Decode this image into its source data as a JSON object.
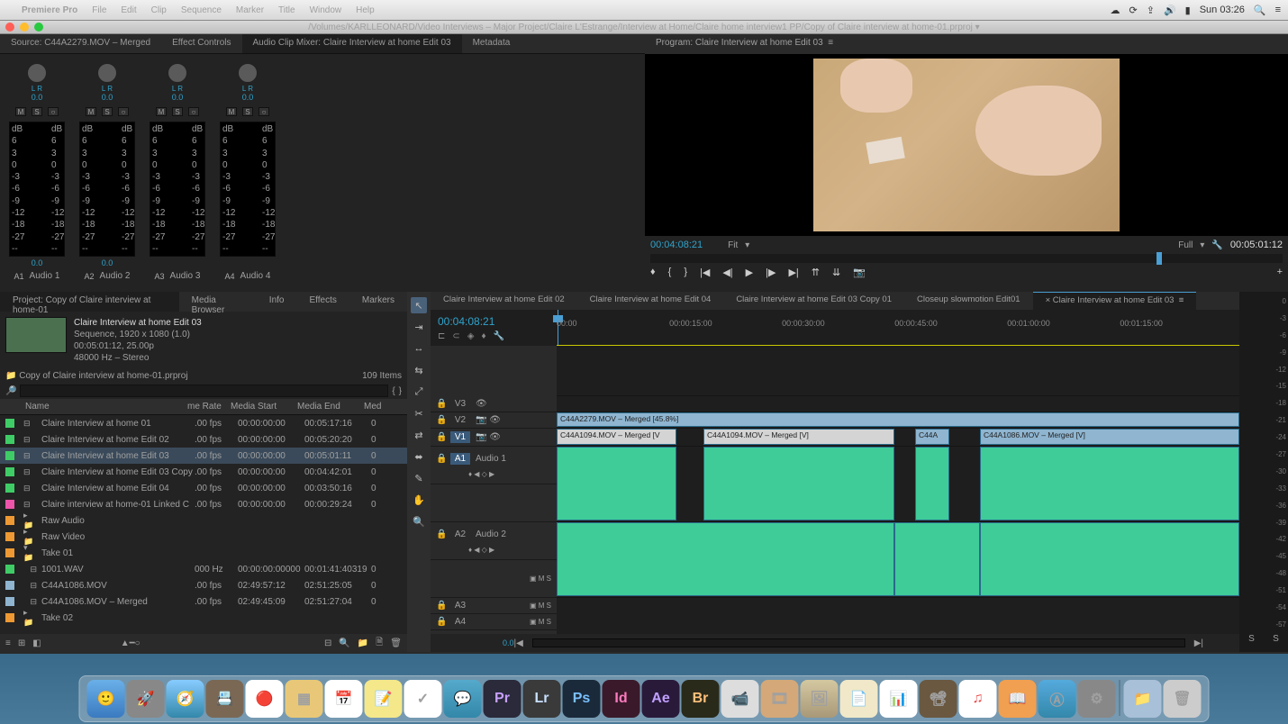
{
  "menubar": {
    "app": "Premiere Pro",
    "items": [
      "File",
      "Edit",
      "Clip",
      "Sequence",
      "Marker",
      "Title",
      "Window",
      "Help"
    ],
    "clock": "Sun 03:26"
  },
  "pathbar": "/Volumes/KARLLEONARD/Video Interviews – Major Project/Claire L'Estrange/Interview at Home/Claire home interview1 PP/Copy of Claire interview at home-01.prproj ▾",
  "source_tabs": {
    "t0": "Source: C44A2279.MOV – Merged",
    "t1": "Effect Controls",
    "t2": "Audio Clip Mixer: Claire Interview at home Edit 03",
    "t3": "Metadata"
  },
  "mixer": {
    "lr": "L   R",
    "val": "0.0",
    "scale": [
      "dB",
      "6",
      "3",
      "0",
      "-3",
      "-6",
      "-9",
      "-12",
      "-18",
      "-27",
      "--"
    ],
    "channels": [
      {
        "id": "A1",
        "name": "Audio 1",
        "pan": "0.0"
      },
      {
        "id": "A2",
        "name": "Audio 2",
        "pan": "0.0"
      },
      {
        "id": "A3",
        "name": "Audio 3"
      },
      {
        "id": "A4",
        "name": "Audio 4"
      }
    ]
  },
  "program": {
    "title": "Program: Claire Interview at home Edit 03",
    "tc": "00:04:08:21",
    "fit": "Fit",
    "full": "Full",
    "dur": "00:05:01:12"
  },
  "project": {
    "tabs": [
      "Project: Copy of Claire interview at home-01",
      "Media Browser",
      "Info",
      "Effects",
      "Markers"
    ],
    "seq_name": "Claire Interview at home Edit 03",
    "seq_meta1": "Sequence, 1920 x 1080 (1.0)",
    "seq_meta2": "00:05:01:12, 25.00p",
    "seq_meta3": "48000 Hz – Stereo",
    "file": "Copy of Claire interview at home-01.prproj",
    "count": "109 Items",
    "cols": [
      "Name",
      "me Rate",
      "Media Start",
      "Media End",
      "Med"
    ],
    "rows": [
      {
        "sw": "#3fcc66",
        "nm": "Claire Interview at home 01",
        "r": ".00 fps",
        "s": "00:00:00:00",
        "e": "00:05:17:16",
        "d": "0"
      },
      {
        "sw": "#3fcc66",
        "nm": "Claire Interview at home Edit 02",
        "r": ".00 fps",
        "s": "00:00:00:00",
        "e": "00:05:20:20",
        "d": "0"
      },
      {
        "sw": "#3fcc66",
        "nm": "Claire Interview at home Edit 03",
        "r": ".00 fps",
        "s": "00:00:00:00",
        "e": "00:05:01:11",
        "d": "0",
        "sel": true
      },
      {
        "sw": "#3fcc66",
        "nm": "Claire Interview at home Edit 03 Copy",
        "r": ".00 fps",
        "s": "00:00:00:00",
        "e": "00:04:42:01",
        "d": "0"
      },
      {
        "sw": "#3fcc66",
        "nm": "Claire Interview at home Edit 04",
        "r": ".00 fps",
        "s": "00:00:00:00",
        "e": "00:03:50:16",
        "d": "0"
      },
      {
        "sw": "#ee55aa",
        "nm": "Claire interview at home-01 Linked C",
        "r": ".00 fps",
        "s": "00:00:00:00",
        "e": "00:00:29:24",
        "d": "0"
      },
      {
        "sw": "#ee9933",
        "nm": "Raw Audio",
        "folder": true
      },
      {
        "sw": "#ee9933",
        "nm": "Raw Video",
        "folder": true
      },
      {
        "sw": "#ee9933",
        "nm": "Take 01",
        "folder": true,
        "open": true
      },
      {
        "sw": "#3fcc66",
        "nm": "1001.WAV",
        "r": "000 Hz",
        "s": "00:00:00:00000",
        "e": "00:01:41:40319",
        "d": "0",
        "indent": true
      },
      {
        "sw": "#8fb5d0",
        "nm": "C44A1086.MOV",
        "r": ".00 fps",
        "s": "02:49:57:12",
        "e": "02:51:25:05",
        "d": "0",
        "indent": true
      },
      {
        "sw": "#8fb5d0",
        "nm": "C44A1086.MOV – Merged",
        "r": ".00 fps",
        "s": "02:49:45:09",
        "e": "02:51:27:04",
        "d": "0",
        "indent": true
      },
      {
        "sw": "#ee9933",
        "nm": "Take 02",
        "folder": true
      }
    ]
  },
  "timeline": {
    "tabs": [
      "Claire Interview at home Edit 02",
      "Claire Interview at home Edit 04",
      "Claire Interview at home Edit 03 Copy 01",
      "Closeup slowmotion Edit01",
      "Claire Interview at home Edit 03"
    ],
    "tc": "00:04:08:21",
    "ticks": [
      "00:00",
      "00:00:15:00",
      "00:00:30:00",
      "00:00:45:00",
      "00:01:00:00",
      "00:01:15:00"
    ],
    "tracks": {
      "v3": "V3",
      "v2": "V2",
      "v1": "V1",
      "a1": "A1",
      "a1n": "Audio 1",
      "a2": "A2",
      "a2n": "Audio 2",
      "a3": "A3",
      "a4": "A4"
    },
    "clips": {
      "v2": "C44A2279.MOV – Merged [45.8%]",
      "v1a": "C44A1094.MOV – Merged [V",
      "v1b": "C44A1094.MOV – Merged [V]",
      "v1c": "C44A",
      "v1d": "C44A1086.MOV – Merged [V]"
    },
    "zoom": "0.0"
  },
  "out_scale": [
    "0",
    "-3",
    "-6",
    "-9",
    "-12",
    "-15",
    "-18",
    "-21",
    "-24",
    "-27",
    "-30",
    "-33",
    "-36",
    "-39",
    "-42",
    "-45",
    "-48",
    "-51",
    "-54",
    "-57"
  ],
  "out_foot": {
    "s": "S"
  }
}
